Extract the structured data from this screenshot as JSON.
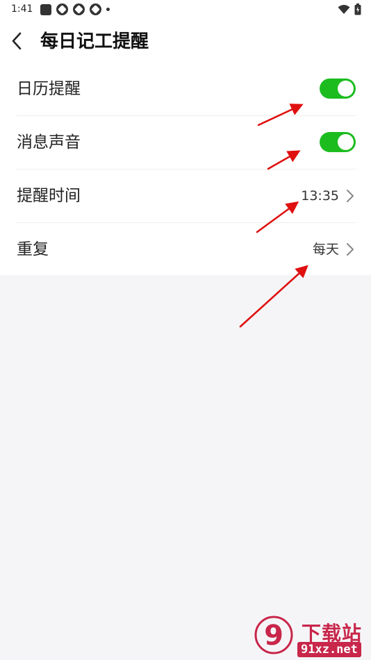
{
  "status_bar": {
    "time": "1:41",
    "left_icons": [
      "square-notification-icon",
      "pinwheel-icon",
      "pinwheel-icon",
      "pinwheel-icon",
      "dot-icon"
    ],
    "right_icons": [
      "wifi-icon",
      "battery-icon"
    ]
  },
  "header": {
    "back_icon": "chevron-left-icon",
    "title": "每日记工提醒"
  },
  "settings": [
    {
      "label": "日历提醒",
      "type": "toggle",
      "enabled": true
    },
    {
      "label": "消息声音",
      "type": "toggle",
      "enabled": true
    },
    {
      "label": "提醒时间",
      "type": "link",
      "value": "13:35"
    },
    {
      "label": "重复",
      "type": "link",
      "value": "每天"
    }
  ],
  "colors": {
    "toggle_on": "#1cbc1f",
    "annotation_arrow": "#e01010",
    "page_background": "#f5f5f7",
    "watermark": "#c8264a"
  },
  "watermark": {
    "logo_text": "9",
    "brand": "下载站",
    "url": "91xz.net"
  }
}
